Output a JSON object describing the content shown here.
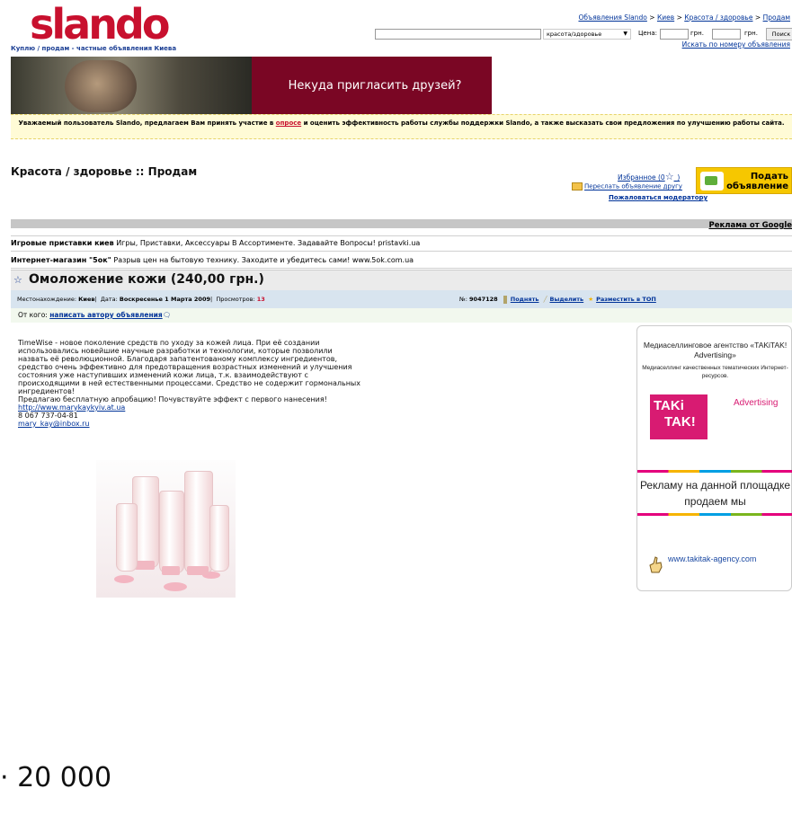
{
  "header": {
    "logo_text": "slando",
    "tagline": "Куплю / продам - частные объявления Киева",
    "breadcrumbs": [
      "Объявления Slando",
      "Киев",
      "Красота / здоровье",
      "Продам"
    ],
    "breadcrumb_sep": ">",
    "search": {
      "value": "",
      "category": "красота/здоровье",
      "price_label": "Цена:",
      "currency1": "грн.",
      "currency2": "грн.",
      "button": "Поиск"
    },
    "search_by_number": "Искать по номеру объявления"
  },
  "banner": {
    "text": "Некуда пригласить друзей?"
  },
  "notice": {
    "before": "Уважаемый пользователь Slando, предлагаем Вам принять участие в ",
    "link": "опросе",
    "after": " и оценить эффективность работы службы поддержки Slando, а также высказать свои предложения по улучшению работы сайта."
  },
  "page": {
    "title": "Красота / здоровье :: Продам",
    "favorites": "Избранное (0",
    "favorites_end": "_)",
    "send_friend": "Переслать объявление другу",
    "complain": "Пожаловаться модератору",
    "post_button_line1": "Подать",
    "post_button_line2": "объявление"
  },
  "ads": {
    "label": "Реклама от Google",
    "items": [
      {
        "title": "Игровые приставки киев",
        "text": " Игры, Приставки, Аксессуары В Ассортименте. Задавайте Вопросы! pristavki.ua"
      },
      {
        "title": "Интернет-магазин \"5ок\"",
        "text": " Разрыв цен на бытовую технику. Заходите и убедитесь сами! www.5ok.com.ua"
      }
    ]
  },
  "listing": {
    "title": "Омоложение кожи (240,00 грн.)",
    "location_label": "Местонахождение: ",
    "location": "Киев",
    "date_label": "Дата: ",
    "date": "Воскресенье 1 Марта 2009",
    "views_label": "Просмотров: ",
    "views": "13",
    "number_label": "№: ",
    "number": "9047128",
    "raise": "Поднять",
    "highlight": "Выделить",
    "top": "Разместить в ТОП",
    "from_label": "От кого: ",
    "from_link": "написать автору объявления",
    "description": [
      "TimeWise - новое поколение средств по уходу за кожей лица. При её создании",
      "использовались новейшие научные разработки и технологии, которые позволили",
      "назвать её революционной. Благодаря запатентованому комплексу ингредиентов,",
      "средство очень эффективно для предотвращения возрастных изменений и улучшения",
      "состояния уже наступивших изменений кожи лица, т.к. взаимодействуют с",
      "происходящими в ней естественными процессами. Средство не содержит гормональных",
      "ингредиентов!",
      "Предлагаю бесплатную апробацию! Почувствуйте эффект с первого нанесения!"
    ],
    "url": "http://www.marykaykyiv.at.ua",
    "phone": "8 067 737-04-81",
    "email": "mary_kay@inbox.ru"
  },
  "side_ad": {
    "agency": "Медиаселлинговое агентство «TAKiTAK! Advertising»",
    "sub": "Медиаселлинг качественных тематических Интернет-ресурсов.",
    "logo_line1": "TAKi",
    "logo_line2": "TAK!",
    "advertising": "Advertising",
    "sell_text": "Рекламу на данной площадке продаем мы",
    "site": "www.takitak-agency.com"
  },
  "footer_number": "· 20 000",
  "colors": {
    "brand_red": "#c8102e",
    "brand_blue": "#1c3f94",
    "banner": "#7a0624",
    "takitak_pink": "#d81b72",
    "post_button": "#f6c700"
  }
}
